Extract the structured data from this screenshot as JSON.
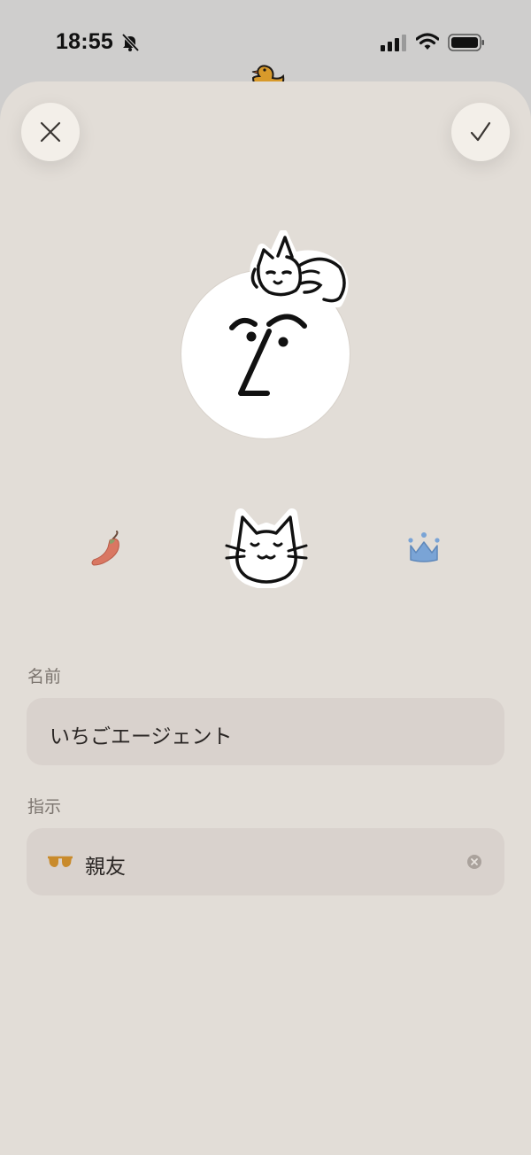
{
  "status": {
    "time": "18:55",
    "bell_icon": "bell-slash-icon",
    "signal_icon": "cellular-signal-icon",
    "wifi_icon": "wifi-icon",
    "battery_icon": "battery-icon"
  },
  "background_sticker": "duck-icon",
  "toolbar": {
    "close_icon": "close-icon",
    "confirm_icon": "checkmark-icon"
  },
  "avatar": {
    "face_icon": "smiling-face-icon",
    "sticker_icon": "lying-cat-icon"
  },
  "sticker_picker": {
    "options": [
      "chili-pepper-icon",
      "cat-face-icon",
      "crown-icon"
    ],
    "selected": "cat-face-icon"
  },
  "form": {
    "name": {
      "label": "名前",
      "value": "いちごエージェント"
    },
    "instruction": {
      "label": "指示",
      "icon": "glasses-icon",
      "value": "親友",
      "clear_icon": "clear-icon"
    }
  },
  "colors": {
    "sheet_background": "#e2ddd7",
    "field_background": "#d9d2cd",
    "label": "#7b746e",
    "pepper": "#d97762",
    "crown": "#7aa4d6",
    "glasses": "#c98b2c",
    "duck": "#d89a2b"
  }
}
